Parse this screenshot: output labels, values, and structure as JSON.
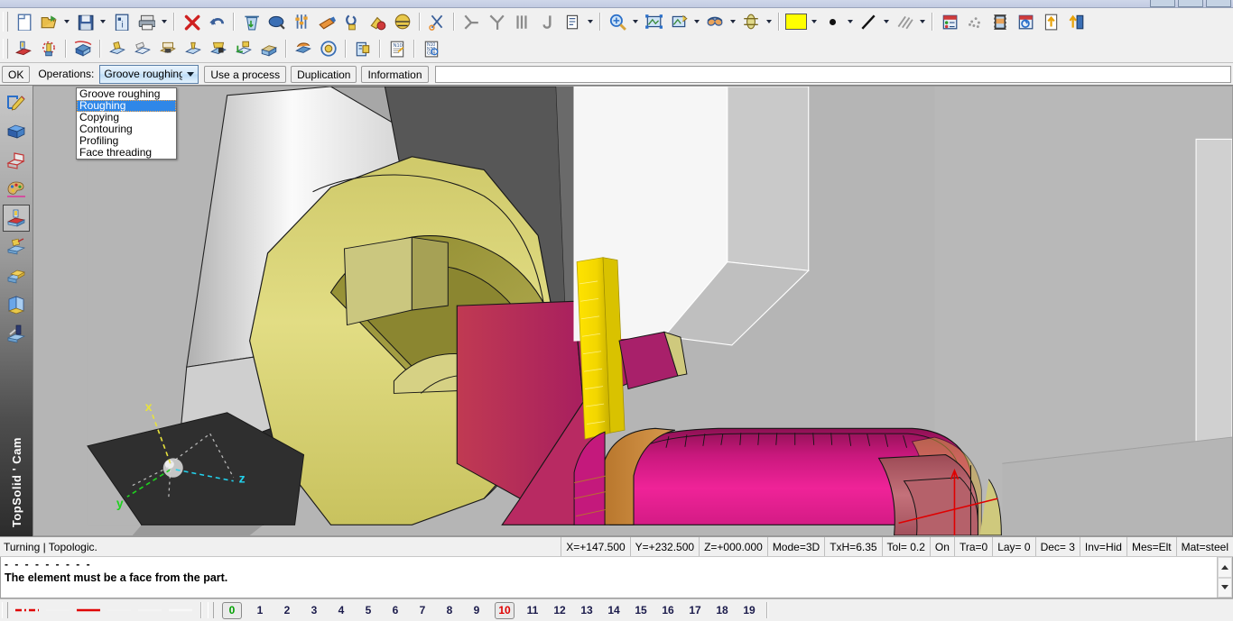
{
  "window": {
    "brand": "TopSolid ' Cam",
    "min_label": "",
    "max_label": "",
    "close_label": ""
  },
  "toolbars": {
    "row1": [
      {
        "name": "new-document-icon",
        "kind": "icon",
        "glyph": "new"
      },
      {
        "name": "open-document-icon",
        "kind": "icon",
        "glyph": "open"
      },
      {
        "name": "open-dropdown-arrow",
        "kind": "arrow"
      },
      {
        "name": "save-icon",
        "kind": "icon",
        "glyph": "save"
      },
      {
        "name": "save-dropdown-arrow",
        "kind": "arrow"
      },
      {
        "name": "document-info-icon",
        "kind": "icon",
        "glyph": "info"
      },
      {
        "name": "print-icon",
        "kind": "icon",
        "glyph": "print"
      },
      {
        "name": "print-dropdown-arrow",
        "kind": "arrow"
      },
      {
        "name": "separator",
        "kind": "sep"
      },
      {
        "name": "delete-icon",
        "kind": "icon",
        "glyph": "delete"
      },
      {
        "name": "undo-icon",
        "kind": "icon",
        "glyph": "undo"
      },
      {
        "name": "separator",
        "kind": "sep"
      },
      {
        "name": "recycle-bin-icon",
        "kind": "icon",
        "glyph": "bin"
      },
      {
        "name": "magnifier-blue-icon",
        "kind": "icon",
        "glyph": "lens"
      },
      {
        "name": "parameters-icon",
        "kind": "icon",
        "glyph": "sliders"
      },
      {
        "name": "tool-orange-icon",
        "kind": "icon",
        "glyph": "toolorange"
      },
      {
        "name": "clamp-icon",
        "kind": "icon",
        "glyph": "clamp"
      },
      {
        "name": "machine-icon",
        "kind": "icon",
        "glyph": "machine"
      },
      {
        "name": "simulate-icon",
        "kind": "icon",
        "glyph": "simulate"
      },
      {
        "name": "separator",
        "kind": "sep"
      },
      {
        "name": "cut-icon",
        "kind": "icon",
        "glyph": "cut"
      },
      {
        "name": "separator",
        "kind": "sep"
      },
      {
        "name": "tangent-icon",
        "kind": "icon",
        "glyph": "tangent"
      },
      {
        "name": "intersect-icon",
        "kind": "icon",
        "glyph": "intersect"
      },
      {
        "name": "parallel-lines-icon",
        "kind": "icon",
        "glyph": "parallel"
      },
      {
        "name": "hook-icon",
        "kind": "icon",
        "glyph": "hook"
      },
      {
        "name": "text-edit-icon",
        "kind": "icon",
        "glyph": "textedit"
      },
      {
        "name": "text-edit-dropdown-arrow",
        "kind": "arrow"
      },
      {
        "name": "separator",
        "kind": "sep"
      },
      {
        "name": "zoom-in-icon",
        "kind": "icon",
        "glyph": "zoomin"
      },
      {
        "name": "zoom-dropdown-arrow",
        "kind": "arrow"
      },
      {
        "name": "zoom-all-icon",
        "kind": "icon",
        "glyph": "zoomall"
      },
      {
        "name": "view-add-icon",
        "kind": "icon",
        "glyph": "viewadd"
      },
      {
        "name": "view-dropdown-arrow",
        "kind": "arrow"
      },
      {
        "name": "glasses-icon",
        "kind": "icon",
        "glyph": "glasses"
      },
      {
        "name": "glasses-dropdown-arrow",
        "kind": "arrow"
      },
      {
        "name": "rotate-view-icon",
        "kind": "icon",
        "glyph": "rotate"
      },
      {
        "name": "rotate-dropdown-arrow",
        "kind": "arrow"
      },
      {
        "name": "separator",
        "kind": "sep"
      },
      {
        "name": "color-swatch",
        "kind": "swatch",
        "color": "#ffff00"
      },
      {
        "name": "color-dropdown-arrow",
        "kind": "arrow"
      },
      {
        "name": "point-style-icon",
        "kind": "dot"
      },
      {
        "name": "point-style-dropdown-arrow",
        "kind": "arrow"
      },
      {
        "name": "line-style-icon",
        "kind": "icon",
        "glyph": "lineslash"
      },
      {
        "name": "line-style-dropdown-arrow",
        "kind": "arrow"
      },
      {
        "name": "hatch-style-icon",
        "kind": "icon",
        "glyph": "hatch"
      },
      {
        "name": "hatch-style-dropdown-arrow",
        "kind": "arrow"
      },
      {
        "name": "separator",
        "kind": "sep"
      },
      {
        "name": "layers-manager-icon",
        "kind": "icon",
        "glyph": "layers"
      },
      {
        "name": "cloud-points-icon",
        "kind": "icon",
        "glyph": "cloud"
      },
      {
        "name": "film-strip-icon",
        "kind": "icon",
        "glyph": "film"
      },
      {
        "name": "render-icon",
        "kind": "icon",
        "glyph": "render"
      },
      {
        "name": "export-up-icon",
        "kind": "icon",
        "glyph": "exportup"
      },
      {
        "name": "import-icon",
        "kind": "icon",
        "glyph": "import"
      }
    ],
    "row2": [
      {
        "name": "turning-machine-icon",
        "kind": "icon",
        "glyph": "lathe"
      },
      {
        "name": "tool-holder-icon",
        "kind": "icon",
        "glyph": "holder"
      },
      {
        "name": "separator",
        "kind": "sep"
      },
      {
        "name": "stock-icon",
        "kind": "icon",
        "glyph": "stock"
      },
      {
        "name": "separator",
        "kind": "sep"
      },
      {
        "name": "roughing-op-icon",
        "kind": "icon",
        "glyph": "rough"
      },
      {
        "name": "finishing-op-icon",
        "kind": "icon",
        "glyph": "finish"
      },
      {
        "name": "grooving-op-icon",
        "kind": "icon",
        "glyph": "groove"
      },
      {
        "name": "drilling-op-icon",
        "kind": "icon",
        "glyph": "drill"
      },
      {
        "name": "threading-op-icon",
        "kind": "icon",
        "glyph": "thread"
      },
      {
        "name": "axis-op-icon",
        "kind": "icon",
        "glyph": "axisop"
      },
      {
        "name": "part-op-icon",
        "kind": "icon",
        "glyph": "partop"
      },
      {
        "name": "separator",
        "kind": "sep"
      },
      {
        "name": "simulation-icon",
        "kind": "icon",
        "glyph": "sim2"
      },
      {
        "name": "cycle-icon",
        "kind": "icon",
        "glyph": "cycle"
      },
      {
        "name": "separator",
        "kind": "sep"
      },
      {
        "name": "post-processor-icon",
        "kind": "icon",
        "glyph": "post"
      },
      {
        "name": "separator",
        "kind": "sep"
      },
      {
        "name": "nc-program-icon",
        "kind": "icon",
        "glyph": "nc1"
      },
      {
        "name": "separator",
        "kind": "sep"
      },
      {
        "name": "nc-code-icon",
        "kind": "icon",
        "glyph": "nc2"
      }
    ]
  },
  "command_bar": {
    "ok_label": "OK",
    "operations_label": "Operations:",
    "selected_operation": "Groove roughing",
    "use_process_label": "Use a process",
    "duplication_label": "Duplication",
    "information_label": "Information",
    "input_value": "",
    "input_placeholder": ""
  },
  "operations_dropdown": {
    "open": true,
    "selected_index": 1,
    "items": [
      "Groove roughing",
      "Roughing",
      "Copying",
      "Contouring",
      "Profiling",
      "Face threading"
    ]
  },
  "sidebar": {
    "active_index": 4,
    "items": [
      {
        "label": "Sketch",
        "icon": "pencil-sketch-icon"
      },
      {
        "label": "Shape",
        "icon": "blue-cube-icon"
      },
      {
        "label": "Sheet metal",
        "icon": "red-fold-icon"
      },
      {
        "label": "Appearance",
        "icon": "palette-icon"
      },
      {
        "label": "Machining",
        "icon": "machining-setup-icon"
      },
      {
        "label": "Tooling",
        "icon": "tooling-icon"
      },
      {
        "label": "Assembly",
        "icon": "assembly-icon"
      },
      {
        "label": "Drafting",
        "icon": "drafting-icon"
      },
      {
        "label": "Mold",
        "icon": "mold-icon"
      }
    ]
  },
  "viewport": {
    "axis_triad": {
      "x_label": "x",
      "y_label": "y",
      "z_label": "z",
      "x_color": "#e8e33c",
      "y_color": "#1fd11f",
      "z_color": "#22d3ee"
    },
    "colors": {
      "background": "#b5b5b5",
      "part_yellow": "#d8d36a",
      "part_magenta": "#e21f8e",
      "part_red": "#c93a5a",
      "tool_yellow": "#ffe81a",
      "holder_white": "#f4f4f4",
      "chuck_dark": "#3a3a3a",
      "origin_marker": "#e00000"
    }
  },
  "statusbar": {
    "mode_text": "Turning | Topologic.",
    "fields": [
      "X=+147.500",
      "Y=+232.500",
      "Z=+000.000",
      "Mode=3D",
      "TxH=6.35",
      "Tol=  0.2",
      "On",
      "Tra=0",
      "Lay=  0",
      "Dec= 3",
      "Inv=Hid",
      "Mes=Elt",
      "Mat=steel"
    ]
  },
  "message_panel": {
    "separator_line": "- - - - - - - - -",
    "message": "The element must be a face from the part."
  },
  "layer_bar": {
    "line_styles": [
      {
        "name": "dash-dot",
        "color": "#e00000",
        "pattern": "dashdot"
      },
      {
        "name": "solid-thin-white",
        "color": "#f2f2f2",
        "pattern": "solid"
      },
      {
        "name": "solid-red",
        "color": "#e00000",
        "pattern": "solid"
      },
      {
        "name": "solid-white-1",
        "color": "#f2f2f2",
        "pattern": "solid"
      },
      {
        "name": "solid-white-2",
        "color": "#f4f4f4",
        "pattern": "solid"
      },
      {
        "name": "solid-white-3",
        "color": "#f8f8f8",
        "pattern": "solid"
      }
    ],
    "layers": [
      "0",
      "1",
      "2",
      "3",
      "4",
      "5",
      "6",
      "7",
      "8",
      "9",
      "10",
      "11",
      "12",
      "13",
      "14",
      "15",
      "16",
      "17",
      "18",
      "19"
    ],
    "active_green": "0",
    "active_red": "10"
  }
}
